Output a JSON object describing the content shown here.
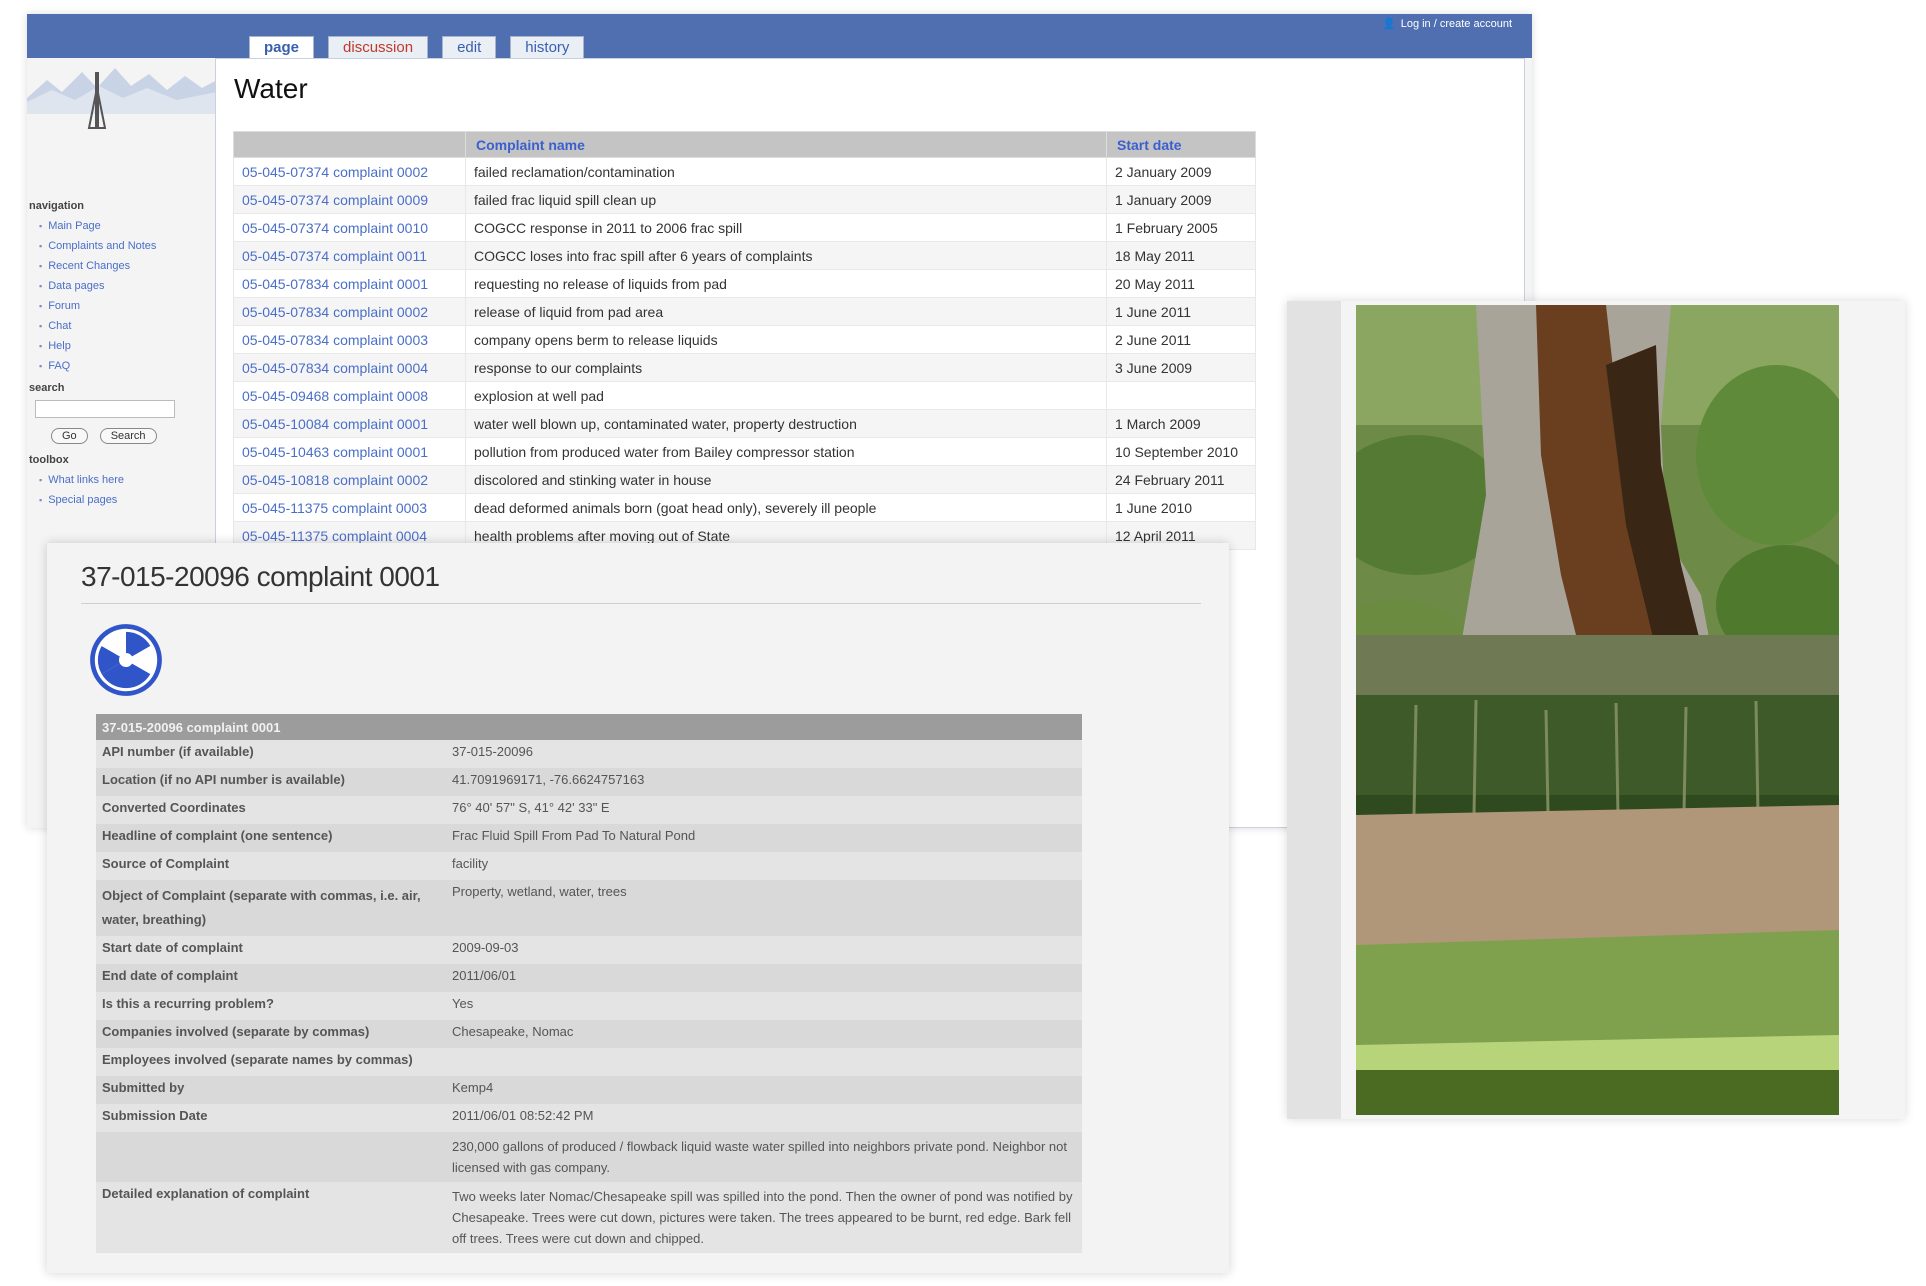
{
  "wiki": {
    "user_tools": "Log in / create account",
    "tabs": [
      {
        "label": "page"
      },
      {
        "label": "discussion"
      },
      {
        "label": "edit"
      },
      {
        "label": "history"
      }
    ],
    "sidebar": {
      "navigation_head": "navigation",
      "nav_items": [
        "Main Page",
        "Complaints and Notes",
        "Recent Changes",
        "Data pages",
        "Forum",
        "Chat",
        "Help",
        "FAQ"
      ],
      "search_head": "search",
      "go_label": "Go",
      "search_label": "Search",
      "toolbox_head": "toolbox",
      "toolbox_items": [
        "What links here",
        "Special pages"
      ]
    },
    "title": "Water",
    "table": {
      "headers": [
        "",
        "Complaint name",
        "Start date"
      ],
      "rows": [
        [
          "05-045-07374 complaint 0002",
          "failed reclamation/contamination",
          "2 January 2009"
        ],
        [
          "05-045-07374 complaint 0009",
          "failed frac liquid spill clean up",
          "1 January 2009"
        ],
        [
          "05-045-07374 complaint 0010",
          "COGCC response in 2011 to 2006 frac spill",
          "1 February 2005"
        ],
        [
          "05-045-07374 complaint 0011",
          "COGCC loses into frac spill after 6 years of complaints",
          "18 May 2011"
        ],
        [
          "05-045-07834 complaint 0001",
          "requesting no release of liquids from pad",
          "20 May 2011"
        ],
        [
          "05-045-07834 complaint 0002",
          "release of liquid from pad area",
          "1 June 2011"
        ],
        [
          "05-045-07834 complaint 0003",
          "company opens berm to release liquids",
          "2 June 2011"
        ],
        [
          "05-045-07834 complaint 0004",
          "response to our complaints",
          "3 June 2009"
        ],
        [
          "05-045-09468 complaint 0008",
          "explosion at well pad",
          ""
        ],
        [
          "05-045-10084 complaint 0001",
          "water well blown up, contaminated water, property destruction",
          "1 March 2009"
        ],
        [
          "05-045-10463 complaint 0001",
          "pollution from produced water from Bailey compressor station",
          "10 September 2010"
        ],
        [
          "05-045-10818 complaint 0002",
          "discolored and stinking water in house",
          "24 February 2011"
        ],
        [
          "05-045-11375 complaint 0003",
          "dead deformed animals born (goat head only), severely ill people",
          "1 June 2010"
        ],
        [
          "05-045-11375 complaint 0004",
          "health problems after moving out of State",
          "12 April 2011"
        ]
      ]
    }
  },
  "detail": {
    "title": "37-015-20096 complaint 0001",
    "logo_icon": "fallout-shelter-icon",
    "table_header": "37-015-20096 complaint 0001",
    "rows": [
      {
        "key": "API number (if available)",
        "value": "37-015-20096",
        "style": "link"
      },
      {
        "key": "Location (if no API number is available)",
        "value": "41.7091969171, -76.6624757163",
        "style": "red"
      },
      {
        "key": "Converted Coordinates",
        "value": "76° 40' 57\" S, 41° 42' 33\" E",
        "style": "orange"
      },
      {
        "key": "Headline of complaint (one sentence)",
        "value": "Frac Fluid Spill From Pad To Natural Pond",
        "style": "plain"
      },
      {
        "key": "Source of Complaint",
        "value": "facility",
        "style": "plain"
      },
      {
        "key": "Object of Complaint (separate with commas, i.e. air, water, breathing)",
        "value": "Property, wetland, water, trees",
        "style": "red"
      },
      {
        "key": "Start date of complaint",
        "value": "2009-09-03",
        "style": "plain"
      },
      {
        "key": "End date of complaint",
        "value": "2011/06/01",
        "style": "plain"
      },
      {
        "key": "Is this a recurring problem?",
        "value": "Yes",
        "style": "plain"
      },
      {
        "key": "Companies involved (separate by commas)",
        "value": "Chesapeake, Nomac",
        "style": "red"
      },
      {
        "key": "Employees involved (separate names by commas)",
        "value": "",
        "style": "plain"
      },
      {
        "key": "Submitted by",
        "value": "Kemp4",
        "style": "plain"
      },
      {
        "key": "Submission Date",
        "value": "2011/06/01 08:52:42 PM",
        "style": "plain"
      },
      {
        "key": "",
        "value": "230,000 gallons of produced / flowback liquid waste water spilled into neighbors private pond. Neighbor not licensed with gas company.",
        "style": "plain"
      },
      {
        "key": "Detailed explanation of complaint",
        "value": "Two weeks later Nomac/Chesapeake spill was spilled into the pond. Then the owner of pond was notified by Chesapeake. Trees were cut down, pictures were taken. The trees appeared to be burnt, red edge. Bark fell off trees. Trees were cut down and chipped.",
        "style": "plain"
      }
    ]
  },
  "photos": {
    "top_alt": "burnt tree trunk",
    "bottom_alt": "spill area and pond"
  }
}
